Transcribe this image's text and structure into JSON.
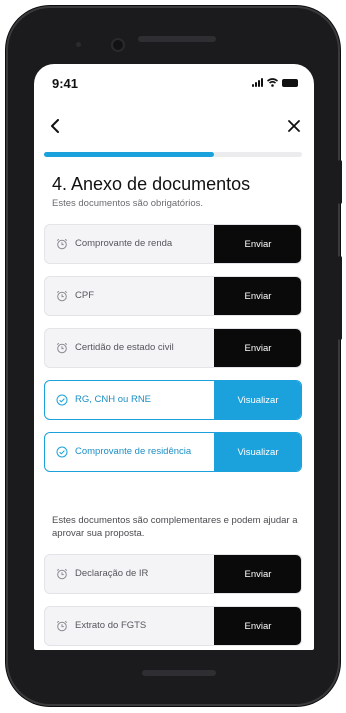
{
  "status_bar": {
    "time": "9:41"
  },
  "nav": {
    "back_icon": "chevron-left-icon",
    "close_icon": "close-icon"
  },
  "progress": {
    "value_fraction": 0.66,
    "color": "#1ba2dc"
  },
  "header": {
    "title": "4. Anexo de documentos",
    "subtitle": "Estes documentos são obrigatórios."
  },
  "required_documents": [
    {
      "label": "Comprovante de renda",
      "action": "Enviar",
      "status": "pending"
    },
    {
      "label": "CPF",
      "action": "Enviar",
      "status": "pending"
    },
    {
      "label": "Certidão de estado civil",
      "action": "Enviar",
      "status": "pending"
    },
    {
      "label": "RG, CNH ou RNE",
      "action": "Visualizar",
      "status": "done"
    },
    {
      "label": "Comprovante de residência",
      "action": "Visualizar",
      "status": "done"
    }
  ],
  "complementary": {
    "text": "Estes documentos são complementares e podem ajudar a aprovar sua proposta.",
    "documents": [
      {
        "label": "Declaração de IR",
        "action": "Enviar",
        "status": "pending"
      },
      {
        "label": "Extrato do FGTS",
        "action": "Enviar",
        "status": "pending"
      }
    ]
  },
  "colors": {
    "accent": "#1ba2dc",
    "button_dark": "#0a0a0a",
    "card_bg": "#f4f4f7"
  }
}
